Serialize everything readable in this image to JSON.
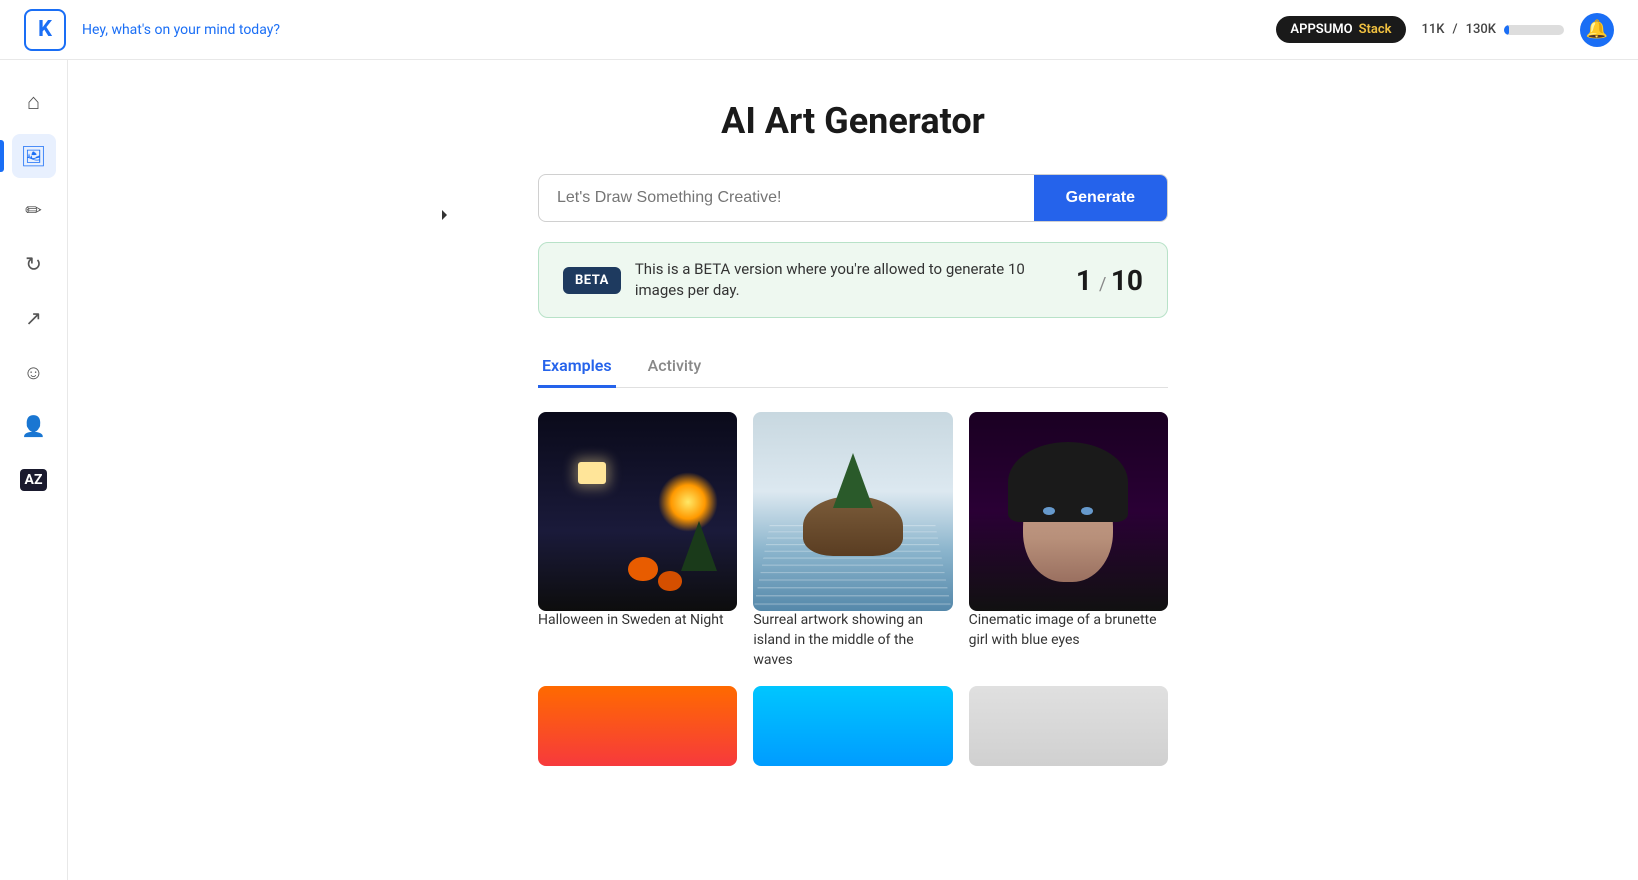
{
  "topnav": {
    "logo": "K",
    "greeting": "Hey, what's on your mind today?",
    "appsumo_label": "APPSUMO",
    "stack_label": "Stack",
    "credits_used": "11K",
    "credits_total": "130K",
    "credits_separator": "/",
    "notif_icon": "🔔"
  },
  "sidebar": {
    "items": [
      {
        "id": "home",
        "icon": "⌂",
        "label": "Home"
      },
      {
        "id": "image",
        "icon": "🖼",
        "label": "Image",
        "active": true
      },
      {
        "id": "edit",
        "icon": "✏",
        "label": "Edit"
      },
      {
        "id": "sync",
        "icon": "↻",
        "label": "Sync"
      },
      {
        "id": "share",
        "icon": "↗",
        "label": "Share"
      },
      {
        "id": "face",
        "icon": "☺",
        "label": "Face"
      },
      {
        "id": "user",
        "icon": "👤",
        "label": "User"
      },
      {
        "id": "az",
        "icon": "AZ",
        "label": "AZ"
      }
    ]
  },
  "main": {
    "page_title": "AI Art Generator",
    "search_placeholder": "Let's Draw Something Creative!",
    "generate_button": "Generate",
    "beta_tag": "BETA",
    "beta_text": "This is a BETA version where you're allowed to generate 10 images per day.",
    "beta_count": "1",
    "beta_slash": "/",
    "beta_total": "10",
    "tabs": [
      {
        "id": "examples",
        "label": "Examples",
        "active": true
      },
      {
        "id": "activity",
        "label": "Activity",
        "active": false
      }
    ],
    "images": [
      {
        "id": "halloween",
        "label": "Halloween in Sweden at Night",
        "type": "halloween"
      },
      {
        "id": "island",
        "label": "Surreal artwork showing an island in the middle of the waves",
        "type": "island"
      },
      {
        "id": "portrait",
        "label": "Cinematic image of a brunette girl with blue eyes",
        "type": "portrait"
      }
    ],
    "row2_images": [
      {
        "id": "fire",
        "type": "fire"
      },
      {
        "id": "alien",
        "type": "alien"
      },
      {
        "id": "gray",
        "type": "gray"
      }
    ]
  }
}
